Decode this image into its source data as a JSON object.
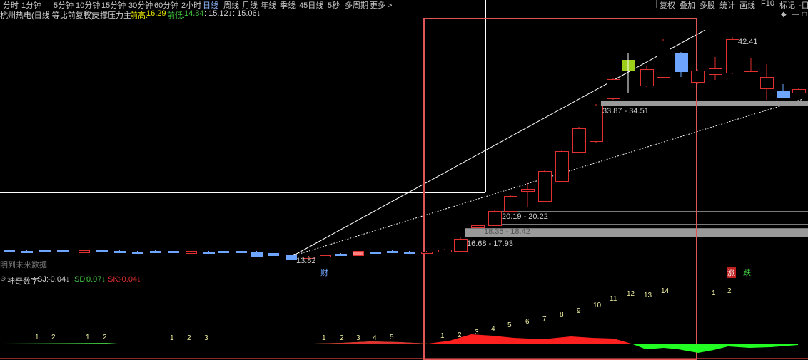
{
  "toolbar": {
    "timeframes": [
      "分时",
      "1分钟",
      "5分钟",
      "10分钟",
      "15分钟",
      "30分钟",
      "60分钟",
      "2小时",
      "日线",
      "周线",
      "月线",
      "年线",
      "季线",
      "45日线",
      "5秒",
      "多周期",
      "更多 >"
    ],
    "active": "日线",
    "right_buttons": [
      "复权",
      "叠加",
      "多股",
      "统计",
      "画线",
      "F10",
      "标记",
      "-目"
    ]
  },
  "header": {
    "title": "杭州热电(日线 等比前复权)",
    "indicator_name": "支撑压力主",
    "prev_high_label": "前高:",
    "prev_high": "16.29",
    "prev_low_label": "前低:",
    "prev_low": "14.84",
    "v3": ": 15.12↓",
    "v4": ": 15.06↓"
  },
  "price_chart": {
    "labels": {
      "low_mark": "13.82",
      "zone1": "16.68 - 17.93",
      "zone2": "18.35 - 18.42",
      "zone3": "20.19 - 20.22",
      "zone4": "33.87 - 34.51",
      "high_mark": "42.41",
      "no_data": "明到未来数据",
      "badge_cai": "财",
      "badge_zhang": "涨",
      "badge_die": "跌"
    },
    "colors": {
      "up": "#e03030",
      "down": "#6ea6ff",
      "zone": "#9a9a9a",
      "highlight": "#9ccf1a",
      "box": "#e05555"
    }
  },
  "indicator": {
    "name": "神奇数字",
    "sj_label": "SJ:",
    "sj": "-0.04↓",
    "sd_label": "SD:",
    "sd": "0.07↓",
    "sk_label": "SK:",
    "sk": "-0.04↓",
    "counts_a": [
      "1",
      "2",
      "1",
      "2",
      "1",
      "2",
      "3",
      "1",
      "2",
      "3",
      "4",
      "5",
      "1",
      "2",
      "3",
      "4",
      "5",
      "6",
      "7",
      "8",
      "9",
      "10"
    ],
    "counts_b": [
      "11",
      "12",
      "13",
      "14",
      "1",
      "2"
    ]
  }
}
